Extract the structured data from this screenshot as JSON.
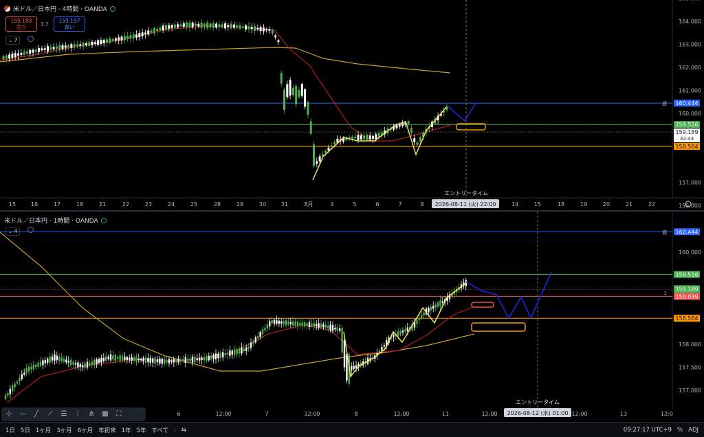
{
  "pane1": {
    "symbol": "米ドル／日本円 · 4時間 · OANDA",
    "sell_price": "159.188",
    "sell_label": "売り",
    "buy_price": "159.197",
    "buy_label": "買い",
    "spread": "1.7",
    "indicator_count": "7",
    "y_labels": [
      "165.000",
      "164.000",
      "163.000",
      "162.000",
      "161.000",
      "160.000",
      "157.000",
      "156.000",
      "155.000"
    ],
    "x_labels": [
      "15",
      "16",
      "17",
      "18",
      "21",
      "22",
      "23",
      "24",
      "25",
      "28",
      "29",
      "30",
      "31",
      "8月",
      "4",
      "5",
      "6",
      "7",
      "8",
      "13",
      "14",
      "15",
      "18",
      "19",
      "20",
      "21",
      "22"
    ],
    "entry_label": "エントリータイム",
    "cursor_time": "2026-08-11 (火)  22:00",
    "line_week_label": "週",
    "line_blue": "160.444",
    "line_green": "159.516",
    "current_price": "159.189",
    "countdown": "32:43",
    "line_orange": "158.564"
  },
  "pane2": {
    "symbol": "米ドル／日本円 · 1時間 · OANDA",
    "indicator_count": "4",
    "y_labels": [
      "160.000",
      "158.000",
      "157.500",
      "157.000"
    ],
    "x_labels": [
      "6",
      "12:00",
      "7",
      "12:00",
      "8",
      "12:00",
      "11",
      "12:00",
      "12:00",
      "13",
      "12:0"
    ],
    "entry_label": "エントリータイム",
    "cursor_time": "2026-08-12 (水)  01:00",
    "line_week_label": "週",
    "line_blue": "160.444",
    "line_green": "159.516",
    "current_price": "159.189",
    "countdown": "32:43",
    "line_red_marker": "1",
    "line_red": "159.039",
    "line_orange": "158.564"
  },
  "bottom": {
    "ranges": [
      "1日",
      "5日",
      "1ヶ月",
      "3ヶ月",
      "6ヶ月",
      "年初来",
      "1年",
      "5年",
      "すべて"
    ],
    "clock": "09:27:17 UTC+9",
    "adj": "ADJ",
    "pct": "%"
  },
  "colors": {
    "up": "#4caf50",
    "down": "#ffffff",
    "ma_short": "#b71c1c",
    "ma_long": "#c9a227",
    "zigzag": "#f2e05a",
    "forecast": "#1e22c9",
    "line_blue": "#2962ff",
    "line_green": "#4caf50",
    "line_orange": "#ff9800",
    "line_red": "#ef5350"
  }
}
